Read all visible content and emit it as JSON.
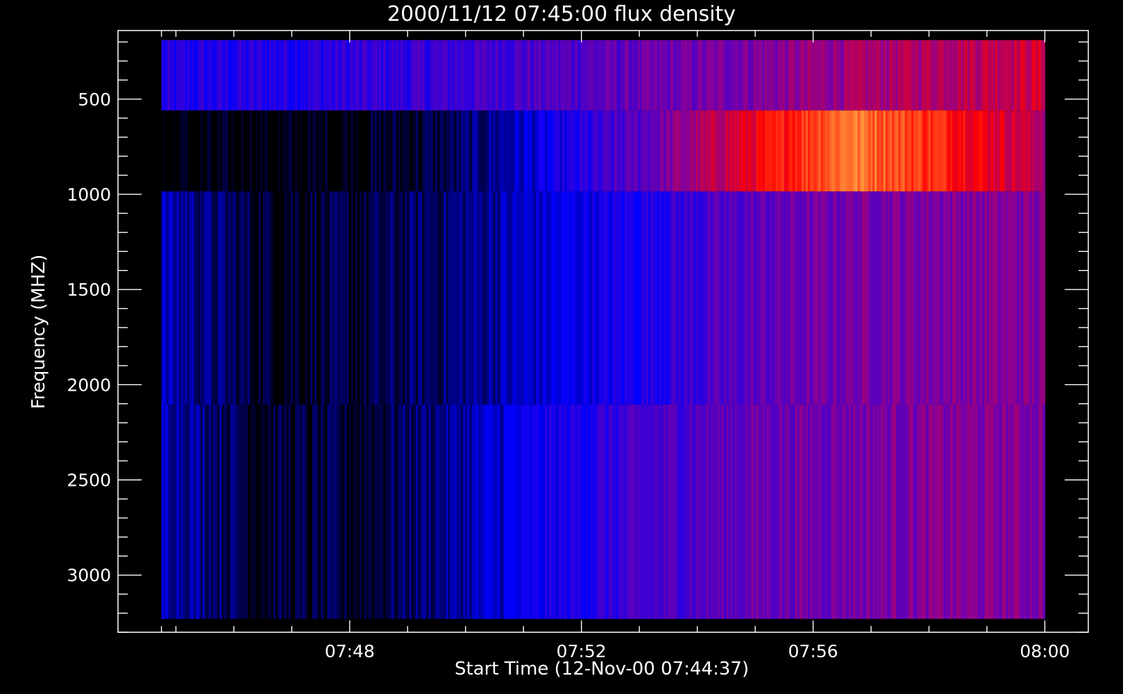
{
  "chart_data": {
    "type": "heatmap",
    "title": "2000/11/12 07:45:00 flux density",
    "xlabel": "Start Time (12-Nov-00 07:44:37)",
    "ylabel": "Frequency (MHZ)",
    "x_ticks": [
      {
        "minute": 48,
        "label": "07:48"
      },
      {
        "minute": 52,
        "label": "07:52"
      },
      {
        "minute": 56,
        "label": "07:56"
      },
      {
        "minute": 60,
        "label": "08:00"
      }
    ],
    "y_ticks": [
      {
        "value": 500,
        "label": "500"
      },
      {
        "value": 1000,
        "label": "1000"
      },
      {
        "value": 1500,
        "label": "1500"
      },
      {
        "value": 2000,
        "label": "2000"
      },
      {
        "value": 2500,
        "label": "2500"
      },
      {
        "value": 3000,
        "label": "3000"
      }
    ],
    "x_range_minutes": [
      44.0,
      60.75
    ],
    "y_range_mhz": [
      140,
      3300
    ],
    "y_inverted": true,
    "data_time_minutes": [
      44.75,
      60.0
    ],
    "bands": [
      {
        "f_min": 190,
        "f_max": 560,
        "profile": [
          0.3,
          0.32,
          0.35,
          0.4,
          0.45,
          0.52,
          0.6,
          0.66
        ]
      },
      {
        "f_min": 560,
        "f_max": 985,
        "profile": [
          0.0,
          0.0,
          0.02,
          0.08,
          0.25,
          0.45,
          0.7,
          0.95,
          0.8,
          0.6
        ]
      },
      {
        "f_min": 985,
        "f_max": 2105,
        "profile": [
          0.18,
          0.05,
          0.05,
          0.12,
          0.22,
          0.32,
          0.42,
          0.48,
          0.5,
          0.5
        ]
      },
      {
        "f_min": 2105,
        "f_max": 3230,
        "profile": [
          0.2,
          0.05,
          0.05,
          0.15,
          0.28,
          0.38,
          0.45,
          0.48,
          0.5,
          0.5
        ]
      }
    ],
    "colormap": [
      "#000000",
      "#0000ff",
      "#8000a0",
      "#ff0000",
      "#ffa040"
    ],
    "grid": false,
    "legend": "none"
  }
}
